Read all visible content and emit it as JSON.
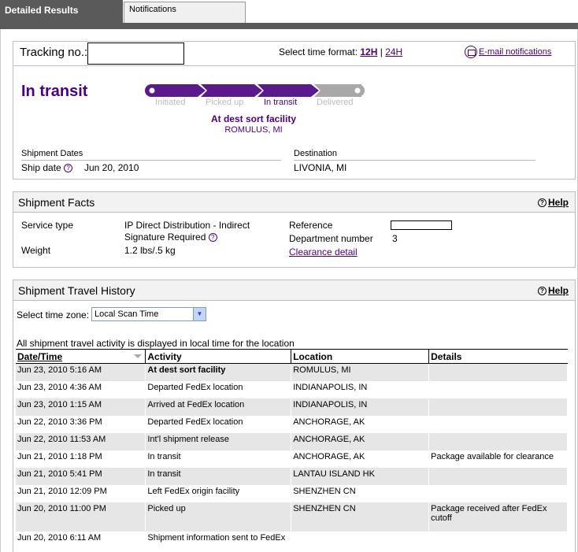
{
  "tabs": {
    "active": "Detailed Results",
    "inactive": "Notifications"
  },
  "tracking": {
    "label": "Tracking no.:",
    "time_format_label": "Select time format:",
    "fmt_12": "12H",
    "fmt_sep": "|",
    "fmt_24": "24H",
    "email_label": "E-mail notifications",
    "status": "In transit",
    "stages": [
      "Initiated",
      "Picked up",
      "In transit",
      "Delivered"
    ],
    "active_stage_index": 2,
    "scan_status": "At dest sort facility",
    "scan_location": "ROMULUS, MI",
    "shipment_dates_header": "Shipment Dates",
    "ship_date_label": "Ship date",
    "ship_date_value": "Jun 20, 2010",
    "destination_header": "Destination",
    "destination_value": "LIVONIA, MI"
  },
  "facts": {
    "title": "Shipment Facts",
    "help": "Help",
    "service_type_label": "Service type",
    "service_type_value": "IP Direct Distribution - Indirect",
    "signature_value": "Signature Required",
    "weight_label": "Weight",
    "weight_value": "1.2 lbs/.5 kg",
    "reference_label": "Reference",
    "department_label": "Department number",
    "department_value": "3",
    "clearance_link": "Clearance detail"
  },
  "history": {
    "title": "Shipment Travel History",
    "help": "Help",
    "tz_label": "Select time zone:",
    "tz_value": "Local Scan Time",
    "note": "All shipment travel activity is displayed in local time for the location",
    "columns": [
      "Date/Time",
      "Activity",
      "Location",
      "Details"
    ],
    "rows": [
      [
        "Jun 23, 2010 5:16 AM",
        "At dest sort facility",
        "ROMULUS, MI",
        ""
      ],
      [
        "Jun 23, 2010 4:36 AM",
        "Departed FedEx location",
        "INDIANAPOLIS, IN",
        ""
      ],
      [
        "Jun 23, 2010 1:15 AM",
        "Arrived at FedEx location",
        "INDIANAPOLIS, IN",
        ""
      ],
      [
        "Jun 22, 2010 3:36 PM",
        "Departed FedEx location",
        "ANCHORAGE, AK",
        ""
      ],
      [
        "Jun 22, 2010 11:53 AM",
        "Int'l shipment release",
        "ANCHORAGE, AK",
        ""
      ],
      [
        "Jun 21, 2010 1:18 PM",
        "In transit",
        "ANCHORAGE, AK",
        "Package available for clearance"
      ],
      [
        "Jun 21, 2010 5:41 PM",
        "In transit",
        "LANTAU ISLAND HK",
        ""
      ],
      [
        "Jun 21, 2010 12:09 PM",
        "Left FedEx origin facility",
        "SHENZHEN CN",
        ""
      ],
      [
        "Jun 20, 2010 11:00 PM",
        "Picked up",
        "SHENZHEN CN",
        "Package received after FedEx cutoff"
      ],
      [
        "Jun 20, 2010 6:11 AM",
        "Shipment information sent to FedEx",
        "",
        ""
      ]
    ]
  }
}
